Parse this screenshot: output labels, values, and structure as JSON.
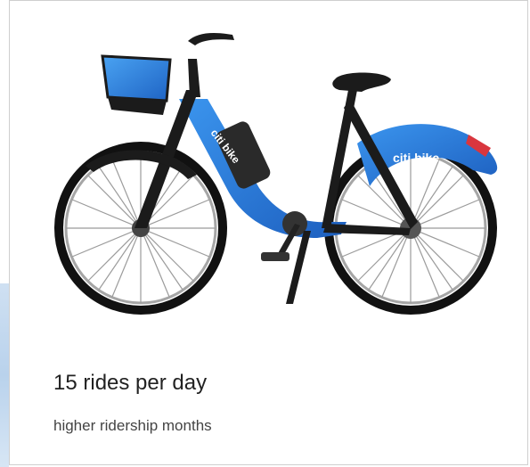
{
  "card": {
    "title": "15 rides per day",
    "subtitle": "higher ridership months"
  },
  "bike": {
    "brand_text_rear": "citi bike",
    "brand_text_frame": "citi bike",
    "icon": "bike-photo",
    "colors": {
      "primary_blue": "#1f6fd1",
      "frame_black": "#1b1b1b",
      "tire": "#111111",
      "light_blue": "#3b8fe6",
      "rear_light": "#d9363e"
    }
  }
}
